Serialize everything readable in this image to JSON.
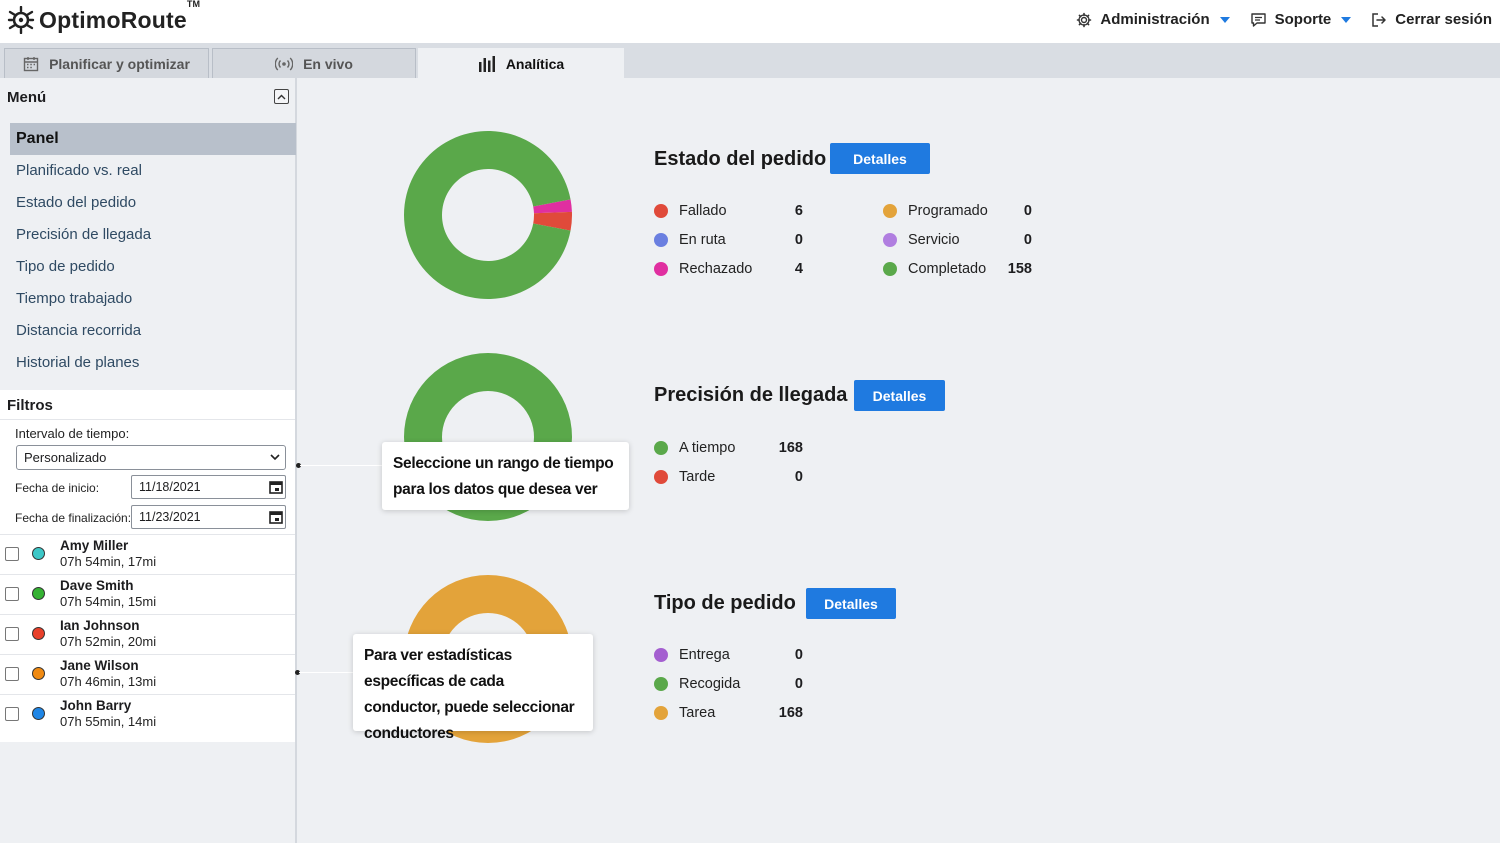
{
  "app": {
    "logo_text": "OptimoRoute",
    "logo_tm": "TM"
  },
  "topnav": {
    "admin_label": "Administración",
    "support_label": "Soporte",
    "logout_label": "Cerrar sesión",
    "accent_color": "#1f7ae0"
  },
  "tabs": [
    {
      "label": "Planificar y optimizar",
      "icon": "calendar-icon",
      "active": false
    },
    {
      "label": "En vivo",
      "icon": "broadcast-icon",
      "active": false
    },
    {
      "label": "Analítica",
      "icon": "bar-chart-icon",
      "active": true
    }
  ],
  "sidebar": {
    "menu_title": "Menú",
    "items": [
      {
        "label": "Panel",
        "active": true
      },
      {
        "label": "Planificado vs. real"
      },
      {
        "label": "Estado del pedido"
      },
      {
        "label": "Precisión de llegada"
      },
      {
        "label": "Tipo de pedido"
      },
      {
        "label": "Tiempo trabajado"
      },
      {
        "label": "Distancia recorrida"
      },
      {
        "label": "Historial de planes"
      }
    ]
  },
  "filters": {
    "title": "Filtros",
    "interval_label": "Intervalo de tiempo:",
    "interval_value": "Personalizado",
    "start_label": "Fecha de inicio:",
    "start_value": "11/18/2021",
    "end_label": "Fecha de finalización:",
    "end_value": "11/23/2021",
    "drivers": [
      {
        "name": "Amy Miller",
        "stats": "07h 54min, 17mi",
        "color": "#3cc7c7"
      },
      {
        "name": "Dave Smith",
        "stats": "07h 54min, 15mi",
        "color": "#35b233"
      },
      {
        "name": "Ian Johnson",
        "stats": "07h 52min, 20mi",
        "color": "#e8402a"
      },
      {
        "name": "Jane Wilson",
        "stats": "07h 46min, 13mi",
        "color": "#f08a12"
      },
      {
        "name": "John Barry",
        "stats": "07h 55min, 14mi",
        "color": "#1f86e6"
      }
    ]
  },
  "sections": {
    "order_status": {
      "title": "Estado del pedido",
      "button": "Detalles",
      "legend": [
        {
          "label": "Fallado",
          "value": "6",
          "color": "#e04a3a"
        },
        {
          "label": "En ruta",
          "value": "0",
          "color": "#6a7fe0"
        },
        {
          "label": "Rechazado",
          "value": "4",
          "color": "#e02fa0"
        },
        {
          "label": "Programado",
          "value": "0",
          "color": "#e3a33a"
        },
        {
          "label": "Servicio",
          "value": "0",
          "color": "#b07ee0"
        },
        {
          "label": "Completado",
          "value": "158",
          "color": "#5aa84a"
        }
      ]
    },
    "arrival_accuracy": {
      "title": "Precisión de llegada",
      "button": "Detalles",
      "legend": [
        {
          "label": "A tiempo",
          "value": "168",
          "color": "#5aa84a"
        },
        {
          "label": "Tarde",
          "value": "0",
          "color": "#e04a3a"
        }
      ]
    },
    "order_type": {
      "title": "Tipo de pedido",
      "button": "Detalles",
      "legend": [
        {
          "label": "Entrega",
          "value": "0",
          "color": "#a45fd0"
        },
        {
          "label": "Recogida",
          "value": "0",
          "color": "#5aa84a"
        },
        {
          "label": "Tarea",
          "value": "168",
          "color": "#e3a33a"
        }
      ]
    }
  },
  "tooltips": {
    "time_range": "Seleccione un rango de tiempo para los datos que desea ver",
    "drivers": "Para ver estadísticas específicas de cada conductor, puede seleccionar conductores"
  }
}
